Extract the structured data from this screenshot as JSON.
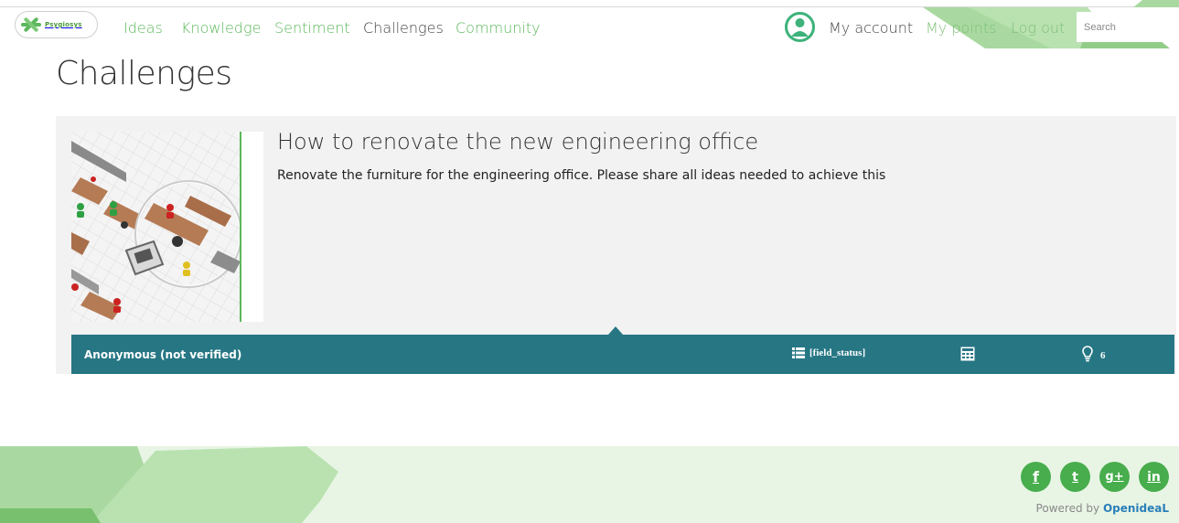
{
  "brand": {
    "logo_text": "Psygiosys"
  },
  "nav": {
    "items": [
      {
        "label": "Ideas"
      },
      {
        "label": "Knowledge"
      },
      {
        "label": "Sentiment"
      },
      {
        "label": "Challenges",
        "active": true
      },
      {
        "label": "Community"
      }
    ]
  },
  "account": {
    "my_account": "My account",
    "my_points": "My points",
    "log_out": "Log out"
  },
  "search": {
    "placeholder": "Search"
  },
  "page": {
    "title": "Challenges"
  },
  "challenge": {
    "title": "How to renovate the new engineering office",
    "description": "Renovate the furniture for the engineering office. Please share all ideas needed to achieve this",
    "author": "Anonymous (not verified)",
    "status": "[field_status]",
    "idea_count": "6"
  },
  "footer": {
    "social": [
      {
        "label": "f",
        "icon": "facebook-icon"
      },
      {
        "label": "t",
        "icon": "twitter-icon"
      },
      {
        "label": "g+",
        "icon": "google-plus-icon"
      },
      {
        "label": "in",
        "icon": "linkedin-icon"
      }
    ],
    "powered_prefix": "Powered by",
    "powered_brand": "OpenideaL"
  },
  "colors": {
    "accent_green": "#5cb85c",
    "bar_teal": "#267684",
    "card_bg": "#f2f2f2",
    "footer_bg": "#e8f5e5"
  }
}
